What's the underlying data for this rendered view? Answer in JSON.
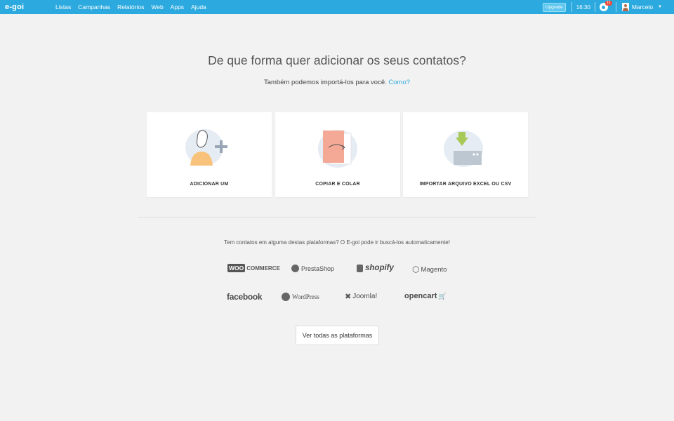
{
  "app": {
    "logo": "e-goi"
  },
  "nav": [
    "Listas",
    "Campanhas",
    "Relatórios",
    "Web",
    "Apps",
    "Ajuda"
  ],
  "topright": {
    "upgrade": "Upgrade",
    "time": "16:30",
    "notifications": "11",
    "user": "Marcelo"
  },
  "main": {
    "title": "De que forma quer adicionar os seus contatos?",
    "subtitle": "Também podemos importá-los para você.",
    "how_link": "Como?"
  },
  "cards": [
    {
      "label": "ADICIONAR UM",
      "icon": "add-user-icon"
    },
    {
      "label": "COPIAR E COLAR",
      "icon": "copy-paste-icon"
    },
    {
      "label": "IMPORTAR ARQUIVO EXCEL OU CSV",
      "icon": "import-file-icon"
    }
  ],
  "platforms": {
    "intro": "Tem contatos em alguma destas plataformas? O E-goi pode ir buscá-los automaticamente!",
    "woo_badge": "WOO",
    "woo_text": "COMMERCE",
    "prestashop": "PrestaShop",
    "shopify": "shopify",
    "magento": "Magento",
    "facebook": "facebook",
    "wordpress": "WordPress",
    "joomla": "Joomla!",
    "opencart": "opencart",
    "see_all": "Ver todas as plataformas"
  },
  "colors": {
    "topbar": "#2caadf",
    "background": "#f2f2f2",
    "link": "#2caadf"
  }
}
